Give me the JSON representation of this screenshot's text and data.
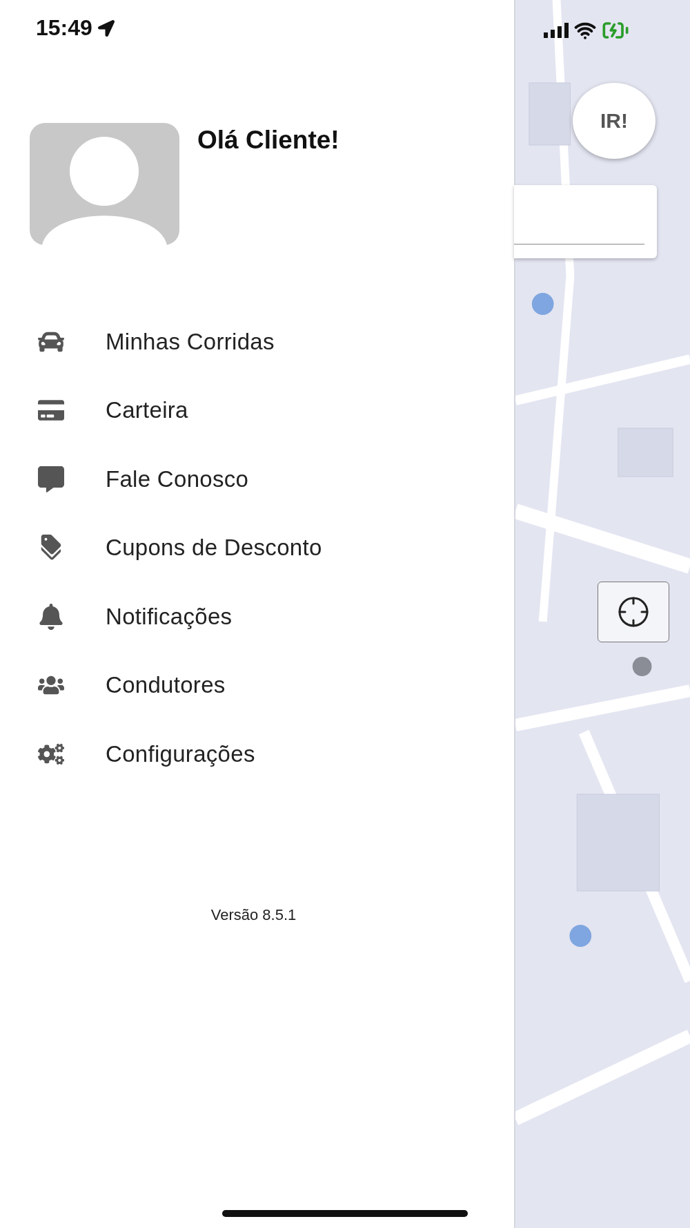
{
  "status_bar": {
    "time": "15:49"
  },
  "profile": {
    "greeting": "Olá Cliente!"
  },
  "menu": [
    {
      "label": "Minhas Corridas"
    },
    {
      "label": "Carteira"
    },
    {
      "label": "Fale Conosco"
    },
    {
      "label": "Cupons de Desconto"
    },
    {
      "label": "Notificações"
    },
    {
      "label": "Condutores"
    },
    {
      "label": "Configurações"
    }
  ],
  "version": "Versão 8.5.1",
  "map": {
    "kind": "picture",
    "go_button": "IR!"
  }
}
